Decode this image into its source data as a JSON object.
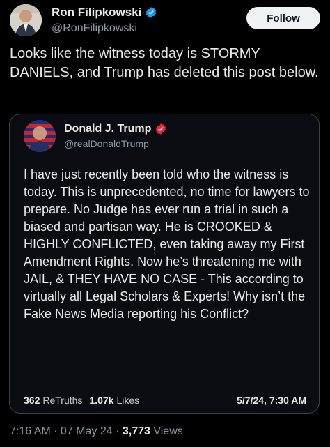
{
  "author": {
    "name": "Ron Filipkowski",
    "handle": "@RonFilipkowski",
    "follow_label": "Follow"
  },
  "tweet": {
    "text": "Looks like the witness today is STORMY DANIELS, and Trump has deleted this post below."
  },
  "quoted": {
    "name": "Donald J. Trump",
    "handle": "@realDonaldTrump",
    "text": "I have just recently been told who the witness is today. This is unprecedented, no time for lawyers to prepare. No Judge has ever run a trial in such a biased and partisan way. He is CROOKED & HIGHLY CONFLICTED, even taking away my First Amendment Rights. Now he’s threatening me with JAIL, & THEY HAVE NO CASE - This according to virtually all Legal Scholars & Experts! Why isn’t the Fake News Media reporting his Conflict?",
    "retruths_count": "362",
    "retruths_label": "ReTruths",
    "likes_count": "1.07k",
    "likes_label": "Likes",
    "date": "5/7/24, 7:30 AM"
  },
  "meta": {
    "time_date": "7:16 AM · 07 May 24 · ",
    "views_count": "3,773",
    "views_label": "Views"
  },
  "colors": {
    "background": "#000000",
    "verified_blue": "#1d9bf0",
    "truth_badge_red": "#e02c3c",
    "follow_button": "#eff3f4"
  }
}
